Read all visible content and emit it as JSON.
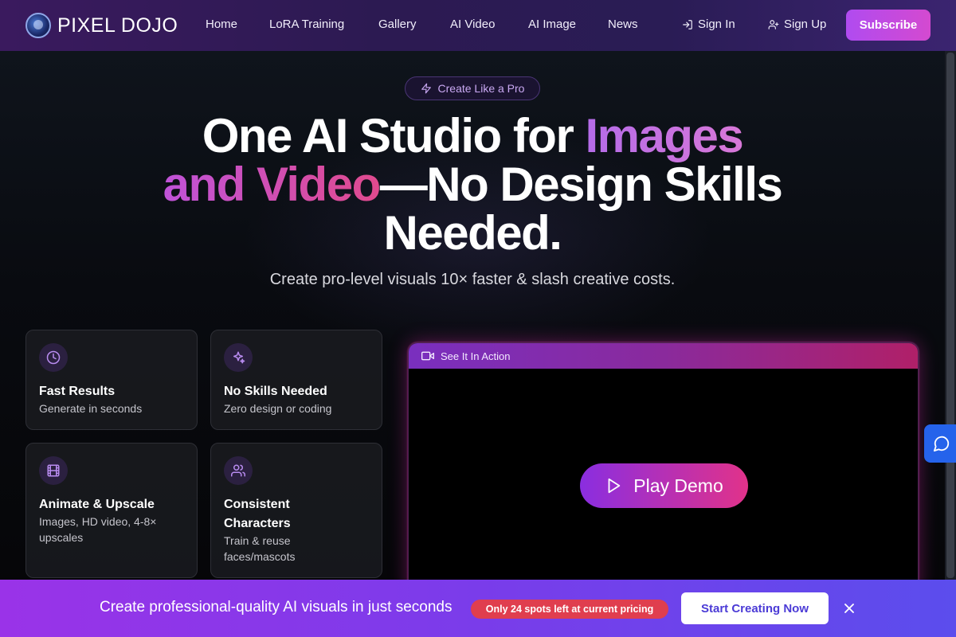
{
  "brand": {
    "name": "PIXEL DOJO"
  },
  "nav": {
    "links": [
      "Home",
      "LoRA Training",
      "Gallery",
      "AI Video",
      "AI Image",
      "News"
    ],
    "sign_in": "Sign In",
    "sign_up": "Sign Up",
    "subscribe": "Subscribe"
  },
  "hero": {
    "pill": "Create Like a Pro",
    "headline_part1": "One AI Studio for ",
    "headline_grad1": "Images",
    "headline_grad2": "and Video",
    "headline_part2": "—No Design Skills Needed.",
    "subhead": "Create pro-level visuals 10× faster & slash creative costs."
  },
  "features": [
    {
      "icon": "clock-icon",
      "title": "Fast Results",
      "desc": "Generate in seconds"
    },
    {
      "icon": "sparkles-icon",
      "title": "No Skills Needed",
      "desc": "Zero design or coding"
    },
    {
      "icon": "film-icon",
      "title": "Animate & Upscale",
      "desc": "Images, HD video, 4-8× upscales"
    },
    {
      "icon": "users-icon",
      "title": "Consistent Characters",
      "desc": "Train & reuse faces/mascots"
    }
  ],
  "video": {
    "bar_label": "See It In Action",
    "play_label": "Play Demo"
  },
  "banner": {
    "text": "Create professional-quality AI visuals in just seconds",
    "badge": "Only 24 spots left at current pricing",
    "cta": "Start Creating Now"
  },
  "colors": {
    "accent_purple": "#b04bf0",
    "accent_pink": "#e1328a",
    "banner_badge": "#e03e4e",
    "chat_blue": "#2563eb"
  }
}
